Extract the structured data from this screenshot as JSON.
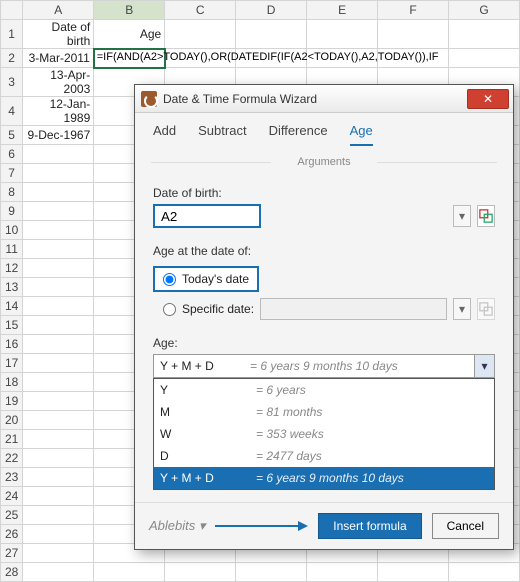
{
  "sheet": {
    "columns": [
      "A",
      "B",
      "C",
      "D",
      "E",
      "F",
      "G"
    ],
    "headers": {
      "A1": "Date of birth",
      "B1": "Age"
    },
    "rows": [
      "3-Mar-2011",
      "13-Apr-2003",
      "12-Jan-1989",
      "9-Dec-1967"
    ],
    "formula": "=IF(AND(A2>TODAY(),OR(DATEDIF(IF(A2<TODAY(),A2,TODAY()),IF",
    "row_count": 28,
    "selected_cell": "B2"
  },
  "dialog": {
    "title": "Date & Time Formula Wizard",
    "tabs": [
      "Add",
      "Subtract",
      "Difference",
      "Age"
    ],
    "active_tab": "Age",
    "arguments_label": "Arguments",
    "dob_label": "Date of birth:",
    "dob_value": "A2",
    "age_at_label": "Age at the date of:",
    "radio_today": "Today's date",
    "radio_specific": "Specific date:",
    "age_label": "Age:",
    "selected_option": {
      "key": "Y + M + D",
      "val": "= 6 years 9 months 10 days"
    },
    "options": [
      {
        "key": "Y",
        "val": "= 6 years"
      },
      {
        "key": "M",
        "val": "= 81 months"
      },
      {
        "key": "W",
        "val": "= 353 weeks"
      },
      {
        "key": "D",
        "val": "= 2477 days"
      },
      {
        "key": "Y + M + D",
        "val": "= 6 years 9 months 10 days"
      }
    ],
    "brand": "Ablebits",
    "insert_btn": "Insert formula",
    "cancel_btn": "Cancel"
  }
}
